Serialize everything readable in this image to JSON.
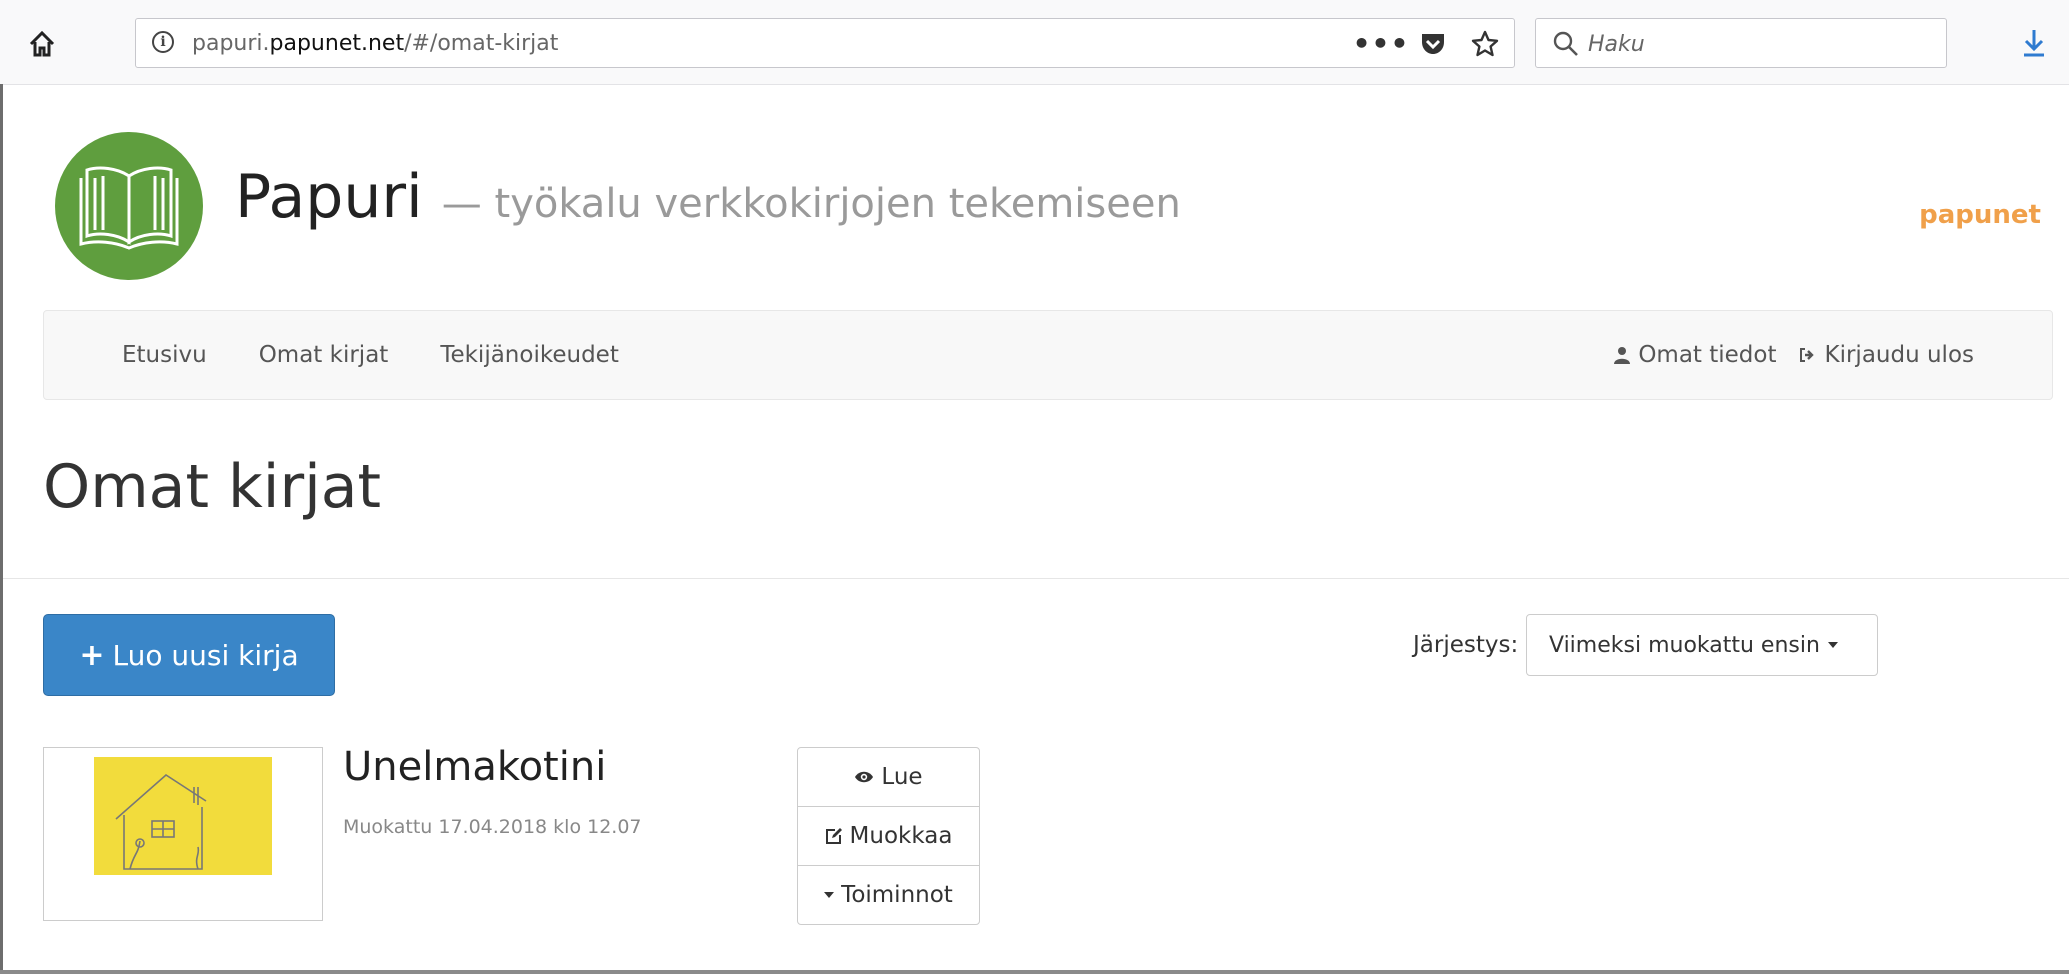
{
  "browser": {
    "url_prefix": "papuri.",
    "url_host": "papunet.net",
    "url_path": "/#/omat-kirjat",
    "search_placeholder": "Haku",
    "more_label": "•••"
  },
  "header": {
    "title": "Papuri",
    "subtitle": "— työkalu verkkokirjojen tekemiseen",
    "brand": "papunet"
  },
  "nav": {
    "left": [
      "Etusivu",
      "Omat kirjat",
      "Tekijänoikeudet"
    ],
    "profile": "Omat tiedot",
    "logout": "Kirjaudu ulos"
  },
  "page": {
    "heading": "Omat kirjat",
    "create_button": "Luo uusi kirja",
    "sort_label": "Järjestys:",
    "sort_value": "Viimeksi muokattu ensin"
  },
  "books": [
    {
      "title": "Unelmakotini",
      "modified": "Muokattu 17.04.2018 klo 12.07",
      "actions": {
        "read": "Lue",
        "edit": "Muokkaa",
        "more": "Toiminnot"
      }
    }
  ],
  "colors": {
    "accent": "#3a86c8",
    "logo_green": "#5f9e3e",
    "brand_orange": "#f0a04a",
    "thumbnail_yellow": "#f2dc3c"
  }
}
